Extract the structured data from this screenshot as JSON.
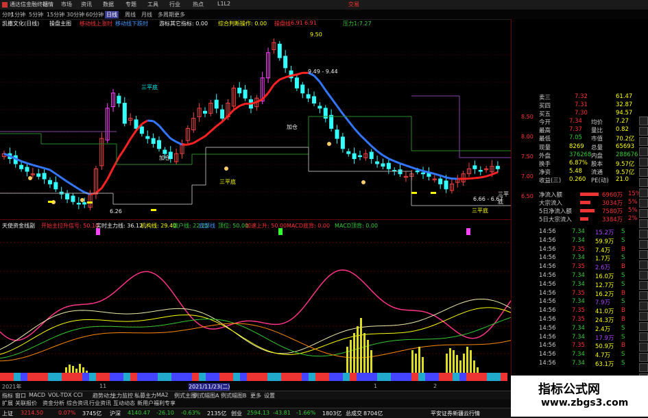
{
  "titlebar": {
    "app": "通达信金融终端",
    "menus": [
      "行情",
      "市场",
      "资讯",
      "数据",
      "专题",
      "工具",
      "行业",
      "热点",
      "L1L2"
    ],
    "right": "交易"
  },
  "periods": [
    "分时",
    "1分钟",
    "5分钟",
    "15分钟",
    "30分钟",
    "60分钟",
    "日线",
    "周线",
    "月线",
    "多周期",
    "更多"
  ],
  "active_period": "日线",
  "infobar": {
    "stock": "凯撒文化(日线)",
    "items": [
      {
        "text": "操盘主图",
        "color": "#eeeeee"
      },
      {
        "text": "移动线上涨时",
        "color": "#ff3333"
      },
      {
        "text": "移动线下跌时",
        "color": "#4499ff"
      },
      {
        "text": "游标其它指标: 0.00",
        "color": "#eeeeee"
      },
      {
        "text": "综合判断操作: 0.00",
        "color": "#ffff00"
      },
      {
        "text": "操盘线",
        "color": "#ff3333"
      },
      {
        "text": "6.91",
        "color": "#ff3333"
      },
      {
        "text": "6.91",
        "color": "#ff3333"
      },
      {
        "text": "压力1:7.27",
        "color": "#33cc33"
      }
    ]
  },
  "chart_annotations": {
    "high_label": "9.50",
    "range_label": "9.49 - 9.44",
    "low_label": "6.26",
    "range_label2": "6.66 - 6.67",
    "tags": [
      "加仓",
      "三平底",
      "加仓",
      "三平底",
      "三平底",
      "三平底"
    ]
  },
  "mid_indicator": [
    {
      "text": "天使资金线副",
      "color": "#eeeeee"
    },
    {
      "text": "开始主拉升信号: 50.10",
      "color": "#ff3333"
    },
    {
      "text": "实时主力线: 36.12",
      "color": "#eeeeee"
    },
    {
      "text": "机构线: 29.40",
      "color": "#ffff00"
    },
    {
      "text": "散户线: 22.25",
      "color": "#33cc33"
    },
    {
      "text": "底部线",
      "color": "#4499ff"
    },
    {
      "text": "顶位: 50.00",
      "color": "#33cc33"
    },
    {
      "text": "加速上升: 50.00",
      "color": "#ff3333"
    },
    {
      "text": "MACD底背: 0.00",
      "color": "#ff3333"
    },
    {
      "text": "MACD顶背: 0.00",
      "color": "#33cc33"
    }
  ],
  "low_axis": [
    "100.00",
    "80.00",
    "80.22",
    "60.00",
    "40.00",
    "20.00"
  ],
  "datebar": [
    "2021年",
    "11",
    "2021/11/23(二)",
    "1",
    "2"
  ],
  "tabs": [
    "指标",
    "窗口",
    "MACD",
    "VOL-TDX",
    "CCI",
    "趋势动力",
    "主力监控",
    "私募主力",
    "MA2",
    "例式主图",
    "例式幅图A",
    "例式幅图B",
    "更多",
    "设置"
  ],
  "tabs2": [
    "扩展",
    "关联报价",
    "资金分析",
    "综合资讯",
    "行业资讯",
    "互动动态",
    "新用户福利专享"
  ],
  "tabs2_right": "模板",
  "status": [
    {
      "label": "上证",
      "value": "3214.50",
      "color": "#ff3333"
    },
    {
      "label": "",
      "value": "0.07%",
      "color": "#ff3333"
    },
    {
      "label": "",
      "value": "3745亿",
      "color": "#eeeeee"
    },
    {
      "label": "沪深",
      "value": "4140.47",
      "color": "#33cc33"
    },
    {
      "label": "",
      "value": "-26.10",
      "color": "#33cc33"
    },
    {
      "label": "",
      "value": "-0.63%",
      "color": "#33cc33"
    },
    {
      "label": "",
      "value": "2135亿",
      "color": "#eeeeee"
    },
    {
      "label": "创业",
      "value": "2594.13",
      "color": "#33cc33"
    },
    {
      "label": "",
      "value": "-43.81",
      "color": "#33cc33"
    },
    {
      "label": "",
      "value": "-1.66%",
      "color": "#33cc33"
    },
    {
      "label": "",
      "value": "1803亿",
      "color": "#eeeeee"
    },
    {
      "label": "总成交",
      "value": "8704亿",
      "color": "#eeeeee"
    },
    {
      "label": "",
      "value": "平安证券新疆云行情",
      "color": "#eeeeee"
    }
  ],
  "rightpanel": {
    "ask_rows": [
      {
        "label": "卖三",
        "price": "7.32",
        "vol": "61.47"
      },
      {
        "label": "买四",
        "price": "7.31",
        "vol": "32.87"
      },
      {
        "label": "买五",
        "price": "7.30",
        "vol": "94.57"
      }
    ],
    "price_axis": [
      "8.50",
      "8.00",
      "7.50",
      "7.00",
      "6.50"
    ],
    "stats": [
      {
        "l1": "今开",
        "v1": "7.34",
        "l2": "均价",
        "v2": "7.27"
      },
      {
        "l1": "最高",
        "v1": "7.37",
        "l2": "量比",
        "v2": "0.82"
      },
      {
        "l1": "最低",
        "v1": "7.05",
        "l2": "市值",
        "v2": "70.2亿"
      },
      {
        "l1": "现量",
        "v1": "8269",
        "l2": "总量",
        "v2": "65693"
      },
      {
        "l1": "外盘",
        "v1": "376268",
        "l2": "内盘",
        "v2": "288676"
      },
      {
        "l1": "换手",
        "v1": "6.87%",
        "l2": "股本",
        "v2": "9.57亿"
      },
      {
        "l1": "净资",
        "v1": "5.48",
        "l2": "流通",
        "v2": "9.57亿"
      },
      {
        "l1": "收益(三)",
        "v1": "0.260",
        "l2": "PE(动)",
        "v2": "21.0"
      }
    ],
    "flows": [
      {
        "label": "净流入额",
        "value": "6960万",
        "pct": "15%",
        "bar": 0.9
      },
      {
        "label": "大宗流入",
        "value": "3034万",
        "pct": "5%",
        "bar": 0.5
      },
      {
        "label": "5日净流入额",
        "value": "7580万",
        "pct": "5%",
        "bar": 0.7
      },
      {
        "label": "5日大宗流入",
        "value": "3384万",
        "pct": "2%",
        "bar": 0.4
      }
    ],
    "ticks": [
      {
        "t": "14:56",
        "p": "7.34",
        "v": "15.2万",
        "s": "S"
      },
      {
        "t": "14:56",
        "p": "7.34",
        "v": "59.9万",
        "s": "S"
      },
      {
        "t": "14:56",
        "p": "7.35",
        "v": "7.4万",
        "s": "B"
      },
      {
        "t": "14:56",
        "p": "7.34",
        "v": "1.7万",
        "s": "S"
      },
      {
        "t": "14:56",
        "p": "7.35",
        "v": "2.6万",
        "s": "B"
      },
      {
        "t": "14:56",
        "p": "7.34",
        "v": "16.0万",
        "s": "S"
      },
      {
        "t": "14:56",
        "p": "7.34",
        "v": "12.7万",
        "s": "S"
      },
      {
        "t": "14:56",
        "p": "7.35",
        "v": "16.2万",
        "s": "B"
      },
      {
        "t": "14:56",
        "p": "7.34",
        "v": "7.9万",
        "s": "S"
      },
      {
        "t": "14:56",
        "p": "7.35",
        "v": "41.0万",
        "s": "B"
      },
      {
        "t": "14:56",
        "p": "7.35",
        "v": "24.3万",
        "s": "B"
      },
      {
        "t": "14:56",
        "p": "7.34",
        "v": "2.4万",
        "s": "S"
      },
      {
        "t": "14:56",
        "p": "7.34",
        "v": "17.9万",
        "s": "S"
      },
      {
        "t": "14:56",
        "p": "7.35",
        "v": "50.9万",
        "s": "B"
      },
      {
        "t": "14:56",
        "p": "7.34",
        "v": "4.7万",
        "s": "S"
      },
      {
        "t": "14:56",
        "p": "7.34",
        "v": "63.1万",
        "s": "S"
      }
    ]
  },
  "watermark": {
    "title": "指标公式网",
    "url": "www.zbgs3.com"
  }
}
